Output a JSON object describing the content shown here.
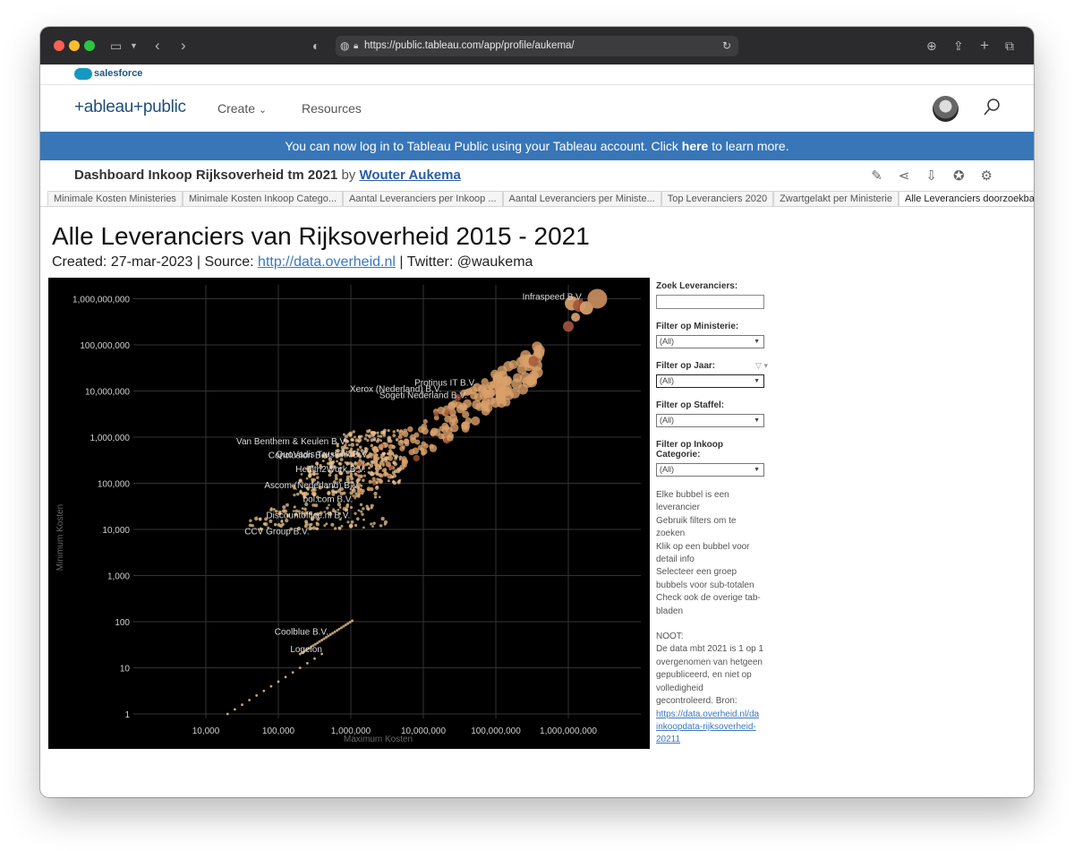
{
  "browser": {
    "url": "https://public.tableau.com/app/profile/aukema/"
  },
  "salesforce": {
    "label": "salesforce"
  },
  "header": {
    "logo": "+ableau+public",
    "nav": [
      {
        "label": "Create"
      },
      {
        "label": "Resources"
      }
    ]
  },
  "banner": {
    "prefix": "You can now log in to Tableau Public using your Tableau account. Click ",
    "link": "here",
    "suffix": " to learn more."
  },
  "viz": {
    "title": "Dashboard Inkoop Rijksoverheid tm 2021",
    "by": "by",
    "author": "Wouter Aukema"
  },
  "tabs": [
    "Minimale Kosten Ministeries",
    "Minimale Kosten Inkoop Catego...",
    "Aantal Leveranciers per Inkoop ...",
    "Aantal Leveranciers per Ministe...",
    "Top Leveranciers 2020",
    "Zwartgelakt per Ministerie",
    "Alle Leveranciers doorzoekbaar"
  ],
  "dashboard": {
    "title": "Alle Leveranciers van Rijksoverheid 2015 - 2021",
    "sub_prefix": "Created: 27-mar-2023 | Source: ",
    "sub_link": "http://data.overheid.nl",
    "sub_suffix": " | Twitter: @waukema"
  },
  "filters": {
    "search_label": "Zoek Leveranciers:",
    "ministerie_label": "Filter op Ministerie:",
    "ministerie_value": "(All)",
    "jaar_label": "Filter op Jaar:",
    "jaar_value": "(All)",
    "staffel_label": "Filter op Staffel:",
    "staffel_value": "(All)",
    "categorie_label": "Filter op Inkoop Categorie:",
    "categorie_value": "(All)"
  },
  "notes": {
    "lines": [
      "Elke bubbel is een",
      "leverancier",
      "Gebruik filters om te",
      "zoeken",
      "Klik op een bubbel voor",
      "detail info",
      "Selecteer een groep",
      "bubbels voor sub-totalen",
      "Check ook de overige tab-",
      "bladen"
    ],
    "noot_lines": [
      "NOOT:",
      "De data mbt 2021 is 1 op 1",
      "overgenomen van hetgeen",
      "gepubliceerd, en niet op",
      "volledigheid",
      "gecontroleerd. Bron:"
    ],
    "link_lines": [
      "https://data.overheid.nl/da",
      "inkoopdata-rijksoverheid-",
      "20211"
    ]
  },
  "chart_data": {
    "type": "scatter",
    "xlabel": "Maximum Kosten",
    "ylabel": "Minimum Kosten",
    "x_scale": "log",
    "y_scale": "log",
    "x_ticks": [
      "10,000",
      "100,000",
      "1,000,000",
      "10,000,000",
      "100,000,000",
      "1,000,000,000"
    ],
    "y_ticks": [
      "1",
      "10",
      "100",
      "1,000",
      "10,000",
      "100,000",
      "1,000,000",
      "10,000,000",
      "100,000,000",
      "1,000,000,000"
    ],
    "xlim": [
      1000,
      10000000000
    ],
    "ylim": [
      0.8,
      2000000000
    ],
    "grid": true,
    "labels": [
      {
        "text": "Infraspeed B.V.",
        "x": 1800000000,
        "y": 1100000000
      },
      {
        "text": "Xerox (Nederland) B.V.",
        "x": 20000000,
        "y": 11000000
      },
      {
        "text": "Protinus IT B.V.",
        "x": 60000000,
        "y": 15000000
      },
      {
        "text": "Sogeti Nederland B.V.",
        "x": 45000000,
        "y": 8000000
      },
      {
        "text": "Van Benthem & Keulen B.V.",
        "x": 1000000,
        "y": 800000
      },
      {
        "text": "Conclusion B.V.",
        "x": 600000,
        "y": 400000
      },
      {
        "text": "QuoVadis Trustlink B.V.",
        "x": 2000000,
        "y": 420000
      },
      {
        "text": "Health2Work B.V.",
        "x": 1800000,
        "y": 200000
      },
      {
        "text": "Ascom (Nederland) B.V.",
        "x": 1500000,
        "y": 90000
      },
      {
        "text": "bol.com B.V.",
        "x": 1200000,
        "y": 45000
      },
      {
        "text": "Discountoffice.nl B.V.",
        "x": 1100000,
        "y": 20000
      },
      {
        "text": "CCV Group B.V.",
        "x": 300000,
        "y": 9000
      },
      {
        "text": "Coolblue B.V.",
        "x": 550000,
        "y": 60
      },
      {
        "text": "Logeion",
        "x": 450000,
        "y": 25
      }
    ],
    "colors": {
      "point": "#e9c28d",
      "bubble": "#d9a06a",
      "bubble_dark": "#a3543a",
      "grid": "#333333",
      "text": "#cfcfcf",
      "axis_title": "#666666"
    }
  }
}
